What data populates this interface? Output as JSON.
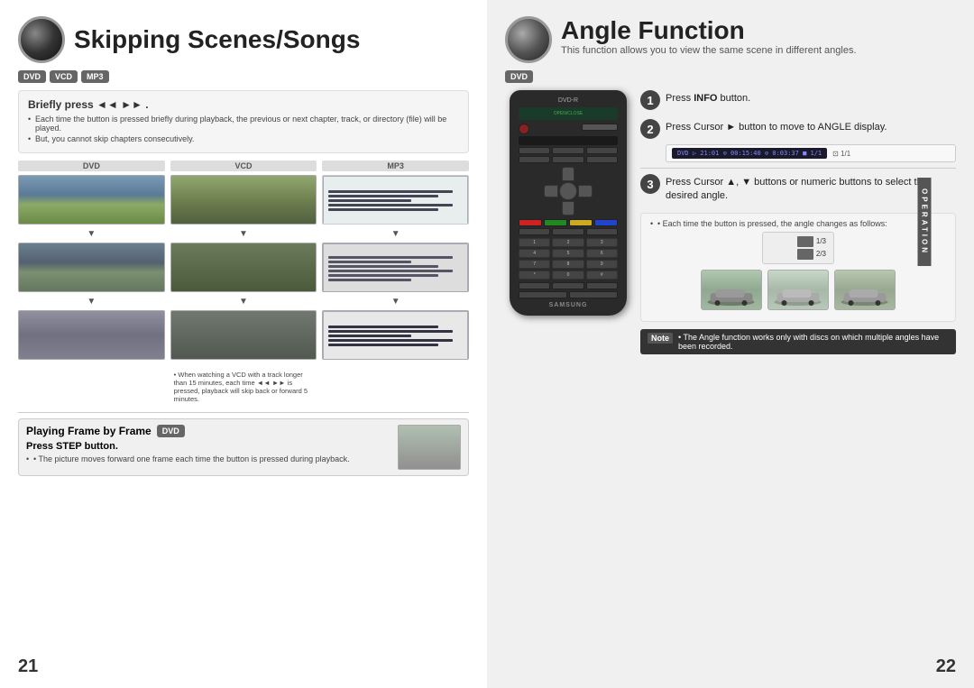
{
  "left": {
    "title": "Skipping Scenes/Songs",
    "badges": [
      "DVD",
      "VCD",
      "MP3"
    ],
    "content_box": {
      "title": "Briefly press ◄◄ ►► .",
      "bullets": [
        "Each time the button is pressed briefly during playback, the previous or next chapter, track, or directory (file) will be played.",
        "But, you cannot skip chapters consecutively."
      ]
    },
    "columns": {
      "dvd_label": "DVD",
      "vcd_label": "VCD",
      "mp3_label": "MP3"
    },
    "vcd_note": "• When watching a VCD with a track longer than 15 minutes, each time ◄◄ ►► is pressed, playback will skip back or forward 5 minutes.",
    "playing_frame": {
      "header": "Playing Frame by Frame",
      "badge": "DVD",
      "step_label": "Press STEP button.",
      "description": "• The picture moves forward one frame each time the button is pressed during playback."
    },
    "page_number": "21"
  },
  "right": {
    "title": "Angle Function",
    "subtitle": "This function allows you to view the same scene in different angles.",
    "badge": "DVD",
    "step1": {
      "number": "1",
      "text": "Press INFO button."
    },
    "step2": {
      "number": "2",
      "text": "Press Cursor ► button to move to ANGLE display."
    },
    "step3": {
      "number": "3",
      "text": "Press Cursor ▲, ▼ buttons or numeric buttons to select the desired angle."
    },
    "angle_note": "• Each time the button is pressed, the angle changes as follows:",
    "operation_label": "OPERATION",
    "note": {
      "label": "Note",
      "text": "• The Angle function works only with discs on which multiple angles have been recorded."
    },
    "page_number": "22",
    "remote": {
      "label": "DVD-R",
      "samsung": "SAMSUNG"
    }
  }
}
